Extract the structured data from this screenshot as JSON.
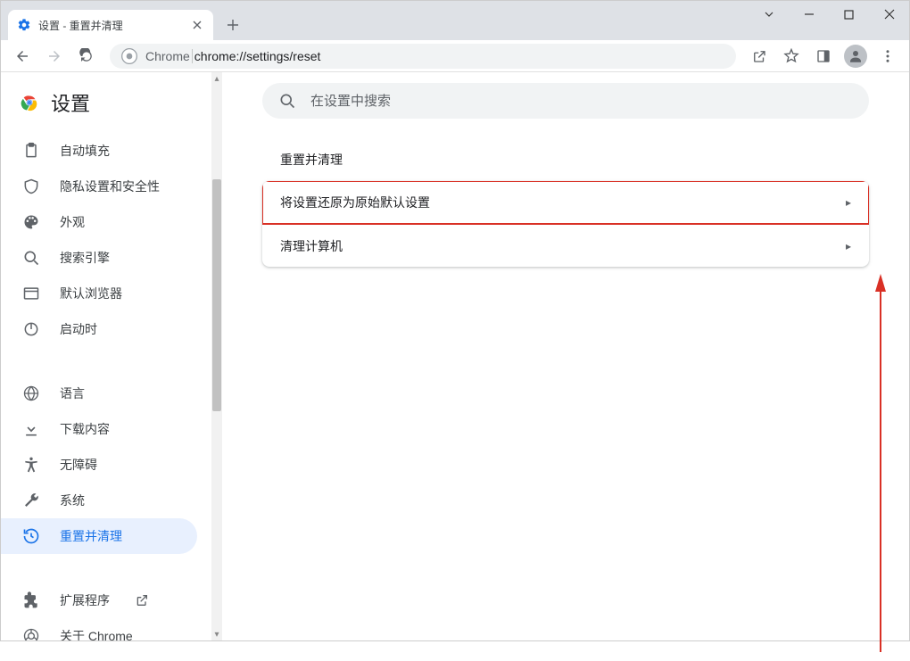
{
  "window": {
    "tab_title": "设置 - 重置并清理"
  },
  "toolbar": {
    "url_prefix": "Chrome",
    "url_path": "chrome://settings/reset"
  },
  "brand": {
    "title": "设置"
  },
  "search": {
    "placeholder": "在设置中搜索"
  },
  "sidebar": {
    "items": [
      {
        "label": "自动填充",
        "icon": "clipboard"
      },
      {
        "label": "隐私设置和安全性",
        "icon": "shield"
      },
      {
        "label": "外观",
        "icon": "palette"
      },
      {
        "label": "搜索引擎",
        "icon": "search"
      },
      {
        "label": "默认浏览器",
        "icon": "window"
      },
      {
        "label": "启动时",
        "icon": "power"
      }
    ],
    "items2": [
      {
        "label": "语言",
        "icon": "globe"
      },
      {
        "label": "下载内容",
        "icon": "download"
      },
      {
        "label": "无障碍",
        "icon": "accessibility"
      },
      {
        "label": "系统",
        "icon": "wrench"
      },
      {
        "label": "重置并清理",
        "icon": "restore",
        "active": true
      }
    ],
    "items3": [
      {
        "label": "扩展程序",
        "icon": "extension",
        "external": true
      },
      {
        "label": "关于 Chrome",
        "icon": "chrome"
      }
    ]
  },
  "section": {
    "title": "重置并清理",
    "rows": [
      {
        "label": "将设置还原为原始默认设置",
        "highlighted": true
      },
      {
        "label": "清理计算机"
      }
    ]
  }
}
